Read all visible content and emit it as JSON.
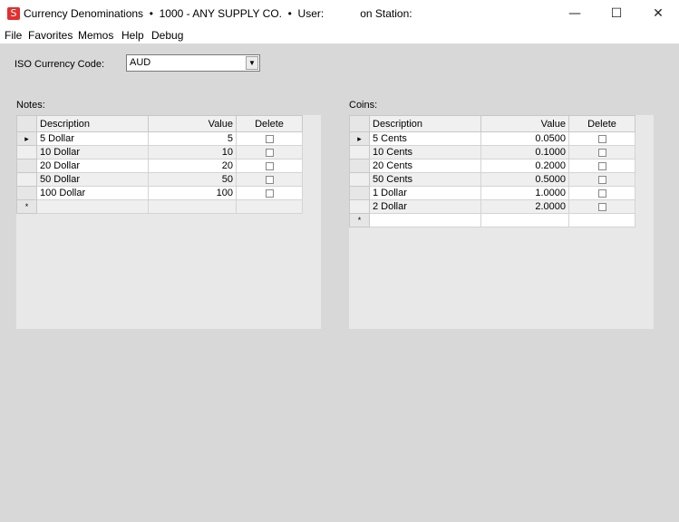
{
  "window": {
    "title": "Currency Denominations  •  1000 - ANY SUPPLY CO.  •  User:            on Station:",
    "icon": "S",
    "minimize": "—",
    "maximize": "☐",
    "close": "✕"
  },
  "menu": [
    "File",
    "Favorites",
    "Memos",
    "Help",
    "Debug"
  ],
  "form": {
    "iso_label": "ISO Currency Code:",
    "iso_value": "AUD",
    "dropdown_arrow": "▼"
  },
  "notes": {
    "label": "Notes:",
    "columns": {
      "description": "Description",
      "value": "Value",
      "delete": "Delete"
    },
    "current_marker": "▸",
    "new_row_marker": "*",
    "rows": [
      {
        "description": "5 Dollar",
        "value": "5"
      },
      {
        "description": "10 Dollar",
        "value": "10"
      },
      {
        "description": "20 Dollar",
        "value": "20"
      },
      {
        "description": "50 Dollar",
        "value": "50"
      },
      {
        "description": "100 Dollar",
        "value": "100"
      }
    ]
  },
  "coins": {
    "label": "Coins:",
    "columns": {
      "description": "Description",
      "value": "Value",
      "delete": "Delete"
    },
    "current_marker": "▸",
    "new_row_marker": "*",
    "rows": [
      {
        "description": "5 Cents",
        "value": "0.0500"
      },
      {
        "description": "10 Cents",
        "value": "0.1000"
      },
      {
        "description": "20 Cents",
        "value": "0.2000"
      },
      {
        "description": "50 Cents",
        "value": "0.5000"
      },
      {
        "description": "1 Dollar",
        "value": "1.0000"
      },
      {
        "description": "2 Dollar",
        "value": "2.0000"
      }
    ]
  }
}
